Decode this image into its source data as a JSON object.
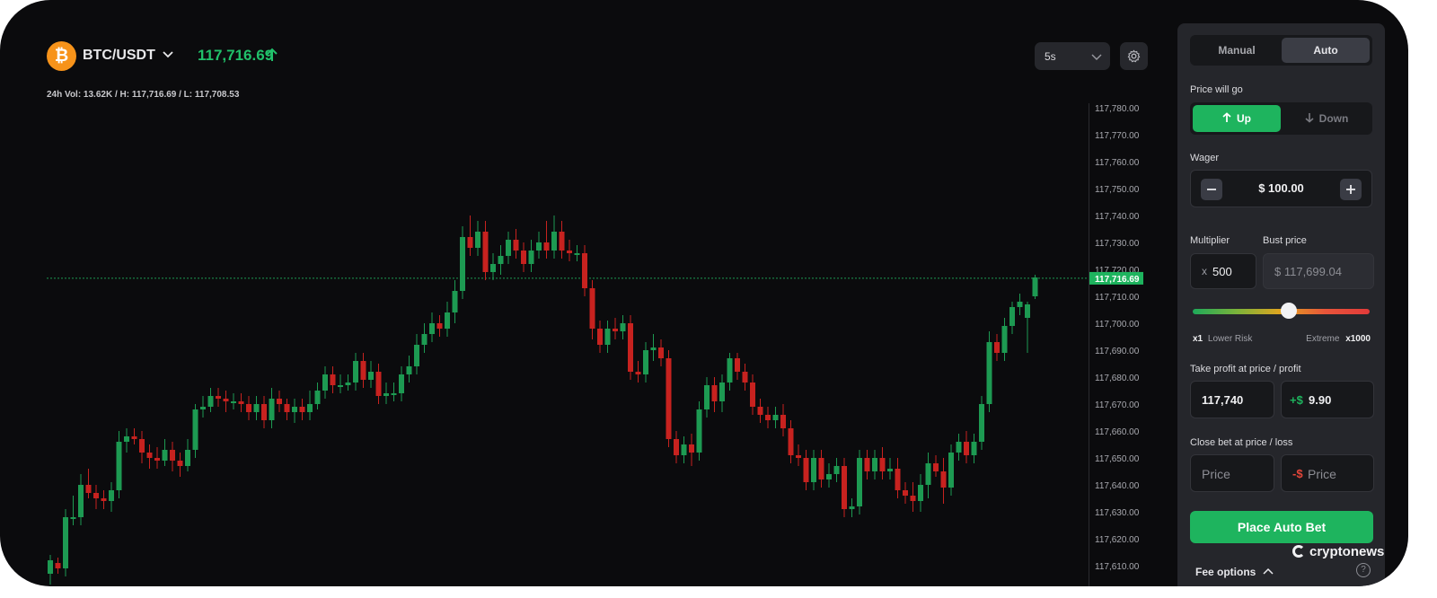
{
  "header": {
    "coin_symbol": "₿",
    "pair": "BTC/USDT",
    "price": "117,716.69",
    "price_color": "#21c06a",
    "stats": "24h Vol: 13.62K / H: 117,716.69 / L: 117,708.53",
    "timeframe": "5s",
    "settings_icon": "gear-icon"
  },
  "chart_data": {
    "type": "candlestick",
    "y_ticks": [
      "117,780.00",
      "117,770.00",
      "117,760.00",
      "117,750.00",
      "117,740.00",
      "117,730.00",
      "117,720.00",
      "117,710.00",
      "117,700.00",
      "117,690.00",
      "117,680.00",
      "117,670.00",
      "117,660.00",
      "117,650.00",
      "117,640.00",
      "117,630.00",
      "117,620.00",
      "117,610.00"
    ],
    "ylim": [
      117605,
      117785
    ],
    "current_price": 117716.69,
    "current_price_label": "117,716.69",
    "up_color": "#1d9a52",
    "down_color": "#c7221f",
    "candles": [
      [
        117607,
        117612,
        117603,
        117614
      ],
      [
        117611,
        117609,
        117607,
        117613
      ],
      [
        117609,
        117628,
        117606,
        117631
      ],
      [
        117628,
        117628,
        117625,
        117636
      ],
      [
        117628,
        117640,
        117625,
        117644
      ],
      [
        117640,
        117637,
        117635,
        117646
      ],
      [
        117637,
        117635,
        117631,
        117640
      ],
      [
        117635,
        117634,
        117631,
        117638
      ],
      [
        117634,
        117638,
        117630,
        117641
      ],
      [
        117638,
        117656,
        117635,
        117660
      ],
      [
        117656,
        117658,
        117652,
        117661
      ],
      [
        117658,
        117657,
        117655,
        117661
      ],
      [
        117657,
        117652,
        117648,
        117660
      ],
      [
        117652,
        117650,
        117646,
        117655
      ],
      [
        117650,
        117649,
        117646,
        117654
      ],
      [
        117649,
        117653,
        117647,
        117657
      ],
      [
        117653,
        117649,
        117645,
        117656
      ],
      [
        117649,
        117647,
        117643,
        117652
      ],
      [
        117647,
        117653,
        117645,
        117657
      ],
      [
        117653,
        117668,
        117650,
        117670
      ],
      [
        117668,
        117669,
        117665,
        117673
      ],
      [
        117669,
        117673,
        117667,
        117676
      ],
      [
        117673,
        117672,
        117669,
        117676
      ],
      [
        117672,
        117671,
        117667,
        117675
      ],
      [
        117671,
        117671,
        117668,
        117674
      ],
      [
        117671,
        117670,
        117667,
        117674
      ],
      [
        117670,
        117667,
        117664,
        117673
      ],
      [
        117667,
        117670,
        117664,
        117673
      ],
      [
        117670,
        117664,
        117661,
        117673
      ],
      [
        117664,
        117672,
        117661,
        117676
      ],
      [
        117672,
        117670,
        117667,
        117675
      ],
      [
        117670,
        117667,
        117664,
        117672
      ],
      [
        117667,
        117669,
        117663,
        117672
      ],
      [
        117669,
        117667,
        117664,
        117672
      ],
      [
        117667,
        117670,
        117664,
        117675
      ],
      [
        117670,
        117675,
        117668,
        117678
      ],
      [
        117675,
        117681,
        117672,
        117684
      ],
      [
        117681,
        117677,
        117674,
        117684
      ],
      [
        117677,
        117677,
        117674,
        117681
      ],
      [
        117677,
        117678,
        117675,
        117681
      ],
      [
        117678,
        117686,
        117675,
        117689
      ],
      [
        117686,
        117679,
        117676,
        117689
      ],
      [
        117679,
        117682,
        117676,
        117686
      ],
      [
        117682,
        117673,
        117670,
        117685
      ],
      [
        117673,
        117674,
        117670,
        117678
      ],
      [
        117674,
        117674,
        117671,
        117678
      ],
      [
        117674,
        117681,
        117671,
        117684
      ],
      [
        117681,
        117684,
        117678,
        117688
      ],
      [
        117684,
        117692,
        117681,
        117696
      ],
      [
        117692,
        117696,
        117689,
        117700
      ],
      [
        117696,
        117700,
        117693,
        117704
      ],
      [
        117700,
        117698,
        117695,
        117703
      ],
      [
        117698,
        117704,
        117695,
        117708
      ],
      [
        117704,
        117712,
        117700,
        117716
      ],
      [
        117712,
        117732,
        117709,
        117736
      ],
      [
        117732,
        117728,
        117725,
        117740
      ],
      [
        117728,
        117734,
        117725,
        117738
      ],
      [
        117734,
        117719,
        117716,
        117738
      ],
      [
        117719,
        117722,
        117716,
        117726
      ],
      [
        117722,
        117725,
        117718,
        117729
      ],
      [
        117725,
        117731,
        117722,
        117734
      ],
      [
        117731,
        117727,
        117724,
        117735
      ],
      [
        117727,
        117722,
        117719,
        117730
      ],
      [
        117722,
        117727,
        117719,
        117731
      ],
      [
        117727,
        117730,
        117724,
        117734
      ],
      [
        117730,
        117727,
        117724,
        117738
      ],
      [
        117727,
        117734,
        117724,
        117740
      ],
      [
        117734,
        117727,
        117724,
        117738
      ],
      [
        117727,
        117726,
        117723,
        117731
      ],
      [
        117726,
        117726,
        117723,
        117729
      ],
      [
        117726,
        117713,
        117710,
        117729
      ],
      [
        117713,
        117698,
        117694,
        117716
      ],
      [
        117698,
        117692,
        117689,
        117701
      ],
      [
        117692,
        117698,
        117689,
        117701
      ],
      [
        117698,
        117697,
        117694,
        117702
      ],
      [
        117697,
        117700,
        117694,
        117703
      ],
      [
        117700,
        117682,
        117679,
        117703
      ],
      [
        117682,
        117681,
        117678,
        117686
      ],
      [
        117681,
        117690,
        117678,
        117693
      ],
      [
        117690,
        117691,
        117686,
        117696
      ],
      [
        117691,
        117687,
        117684,
        117694
      ],
      [
        117687,
        117657,
        117654,
        117690
      ],
      [
        117657,
        117651,
        117648,
        117660
      ],
      [
        117651,
        117655,
        117648,
        117658
      ],
      [
        117655,
        117652,
        117647,
        117659
      ],
      [
        117652,
        117668,
        117649,
        117671
      ],
      [
        117668,
        117677,
        117665,
        117680
      ],
      [
        117677,
        117671,
        117667,
        117680
      ],
      [
        117671,
        117678,
        117667,
        117681
      ],
      [
        117678,
        117687,
        117675,
        117689
      ],
      [
        117687,
        117682,
        117679,
        117689
      ],
      [
        117682,
        117678,
        117675,
        117685
      ],
      [
        117678,
        117669,
        117666,
        117681
      ],
      [
        117669,
        117666,
        117663,
        117672
      ],
      [
        117666,
        117664,
        117661,
        117669
      ],
      [
        117664,
        117666,
        117661,
        117669
      ],
      [
        117666,
        117661,
        117658,
        117670
      ],
      [
        117661,
        117651,
        117648,
        117664
      ],
      [
        117651,
        117650,
        117647,
        117655
      ],
      [
        117650,
        117641,
        117638,
        117653
      ],
      [
        117641,
        117650,
        117638,
        117653
      ],
      [
        117650,
        117642,
        117639,
        117653
      ],
      [
        117642,
        117644,
        117639,
        117648
      ],
      [
        117644,
        117647,
        117641,
        117650
      ],
      [
        117647,
        117631,
        117628,
        117650
      ],
      [
        117631,
        117632,
        117628,
        117635
      ],
      [
        117632,
        117650,
        117629,
        117653
      ],
      [
        117650,
        117645,
        117642,
        117653
      ],
      [
        117645,
        117650,
        117642,
        117653
      ],
      [
        117650,
        117645,
        117642,
        117654
      ],
      [
        117645,
        117646,
        117642,
        117650
      ],
      [
        117646,
        117638,
        117635,
        117650
      ],
      [
        117638,
        117636,
        117633,
        117641
      ],
      [
        117636,
        117634,
        117630,
        117641
      ],
      [
        117634,
        117640,
        117630,
        117644
      ],
      [
        117640,
        117648,
        117635,
        117652
      ],
      [
        117648,
        117645,
        117643,
        117651
      ],
      [
        117645,
        117639,
        117633,
        117650
      ],
      [
        117639,
        117652,
        117636,
        117655
      ],
      [
        117652,
        117656,
        117649,
        117659
      ],
      [
        117656,
        117651,
        117648,
        117660
      ],
      [
        117651,
        117656,
        117648,
        117659
      ],
      [
        117656,
        117670,
        117653,
        117673
      ],
      [
        117670,
        117693,
        117667,
        117697
      ],
      [
        117693,
        117689,
        117686,
        117696
      ],
      [
        117689,
        117699,
        117686,
        117702
      ],
      [
        117699,
        117706,
        117696,
        117708
      ],
      [
        117706,
        117708,
        117703,
        117711
      ],
      [
        117702,
        117707,
        117689,
        117708
      ],
      [
        117710,
        117717,
        117709,
        117718
      ]
    ]
  },
  "panel": {
    "tabs": [
      {
        "label": "Manual"
      },
      {
        "label": "Auto"
      }
    ],
    "direction_label": "Price will go",
    "up_label": "Up",
    "down_label": "Down",
    "wager_label": "Wager",
    "wager_value": "$ 100.00",
    "multiplier_label": "Multiplier",
    "multiplier_prefix": "x",
    "multiplier_value": "500",
    "bust_label": "Bust price",
    "bust_value": "$ 117,699.04",
    "slider_left_x": "x1",
    "slider_left_text": "Lower Risk",
    "slider_right_text": "Extreme",
    "slider_right_x": "x1000",
    "multiplier_level_fraction": 0.5,
    "take_profit_label": "Take profit at price / profit",
    "take_profit_price": "117,740",
    "take_profit_sign": "+$",
    "take_profit_amount": "9.90",
    "close_label": "Close bet at price / loss",
    "close_price_placeholder": "Price",
    "close_loss_sign": "-$",
    "close_loss_placeholder": "Price",
    "place_button": "Place Auto Bet",
    "fee_options": "Fee options",
    "help_icon": "?"
  },
  "brand": "cryptonews"
}
